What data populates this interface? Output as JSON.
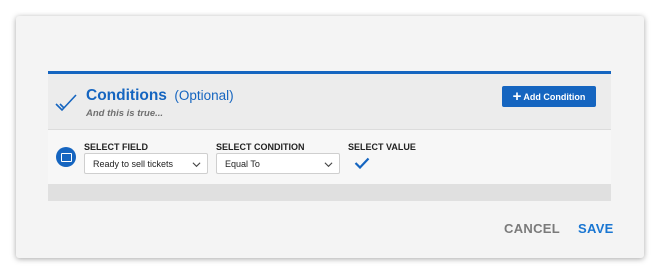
{
  "conditions": {
    "title": "Conditions",
    "optional_label": "(Optional)",
    "subtitle": "And this is true...",
    "add_button_label": "Add Condition",
    "accent_color": "#1565c0"
  },
  "condition_row": {
    "field_label": "SELECT FIELD",
    "field_value": "Ready to sell tickets",
    "condition_label": "SELECT CONDITION",
    "condition_value": "Equal To",
    "value_label": "SELECT VALUE",
    "value_checked": true
  },
  "footer": {
    "cancel_label": "CANCEL",
    "save_label": "SAVE"
  },
  "icons": {
    "header": "checkmark-icon",
    "row": "condition-icon",
    "add": "plus-icon",
    "dropdown": "chevron-down-icon"
  }
}
